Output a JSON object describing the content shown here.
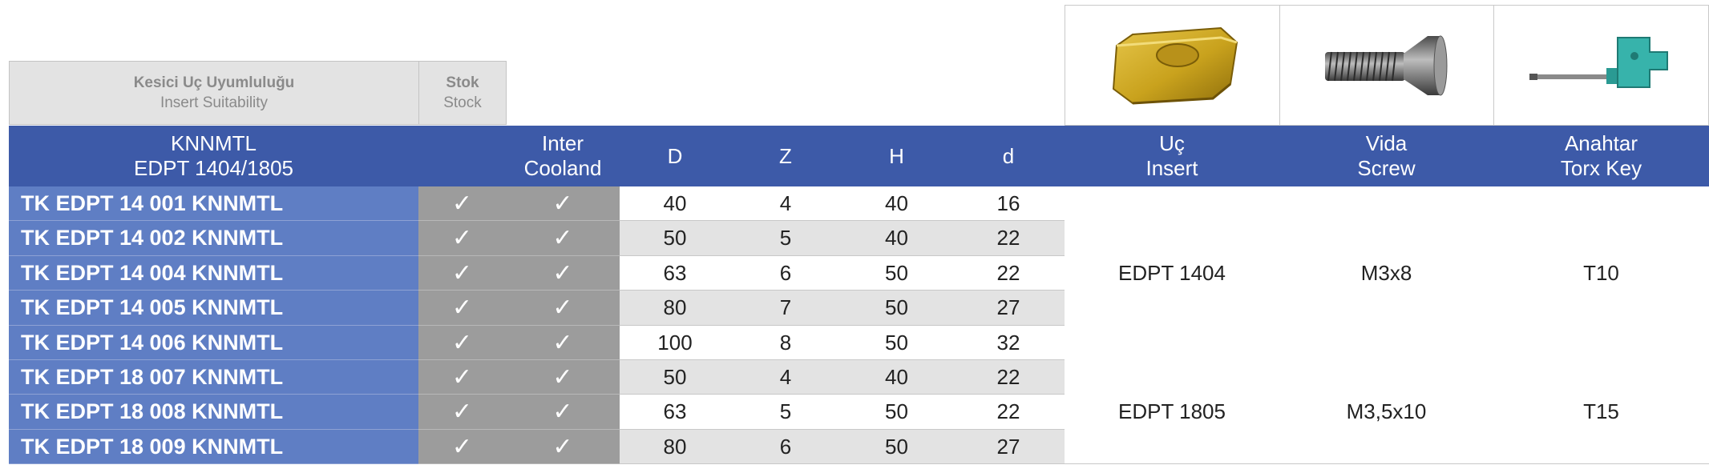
{
  "legend": {
    "suitability": {
      "tr": "Kesici Uç Uyumluluğu",
      "en": "Insert Suitability"
    },
    "stock": {
      "tr": "Stok",
      "en": "Stock"
    }
  },
  "images": [
    {
      "name": "insert-image",
      "icon": "insert-icon"
    },
    {
      "name": "screw-image",
      "icon": "screw-icon"
    },
    {
      "name": "torx-key-image",
      "icon": "torx-key-icon"
    }
  ],
  "colors": {
    "header_blue": "#3d5aa8",
    "name_blue": "#5f7ec4",
    "check_grey": "#9c9c9c",
    "row_alt": "#e3e3e3"
  },
  "header": {
    "series_line1": "KNNMTL",
    "series_line2": "EDPT 1404/1805",
    "stock_col": "",
    "coolant_line1": "Inter",
    "coolant_line2": "Cooland",
    "d_big": "D",
    "z": "Z",
    "h": "H",
    "d_small": "d",
    "insert_line1": "Uç",
    "insert_line2": "Insert",
    "screw_line1": "Vida",
    "screw_line2": "Screw",
    "key_line1": "Anahtar",
    "key_line2": "Torx Key"
  },
  "rows": [
    {
      "name": "TK EDPT 14 001 KNNMTL",
      "stock": "✓",
      "coolant": "✓",
      "D": "40",
      "Z": "4",
      "H": "40",
      "d": "16"
    },
    {
      "name": "TK EDPT 14 002 KNNMTL",
      "stock": "✓",
      "coolant": "✓",
      "D": "50",
      "Z": "5",
      "H": "40",
      "d": "22"
    },
    {
      "name": "TK EDPT 14 004 KNNMTL",
      "stock": "✓",
      "coolant": "✓",
      "D": "63",
      "Z": "6",
      "H": "50",
      "d": "22"
    },
    {
      "name": "TK EDPT 14 005 KNNMTL",
      "stock": "✓",
      "coolant": "✓",
      "D": "80",
      "Z": "7",
      "H": "50",
      "d": "27"
    },
    {
      "name": "TK EDPT 14 006 KNNMTL",
      "stock": "✓",
      "coolant": "✓",
      "D": "100",
      "Z": "8",
      "H": "50",
      "d": "32"
    },
    {
      "name": "TK EDPT 18 007 KNNMTL",
      "stock": "✓",
      "coolant": "✓",
      "D": "50",
      "Z": "4",
      "H": "40",
      "d": "22"
    },
    {
      "name": "TK EDPT 18 008 KNNMTL",
      "stock": "✓",
      "coolant": "✓",
      "D": "63",
      "Z": "5",
      "H": "50",
      "d": "22"
    },
    {
      "name": "TK EDPT 18 009 KNNMTL",
      "stock": "✓",
      "coolant": "✓",
      "D": "80",
      "Z": "6",
      "H": "50",
      "d": "27"
    }
  ],
  "groups": [
    {
      "insert": "EDPT 1404",
      "screw": "M3x8",
      "key": "T10"
    },
    {
      "insert": "EDPT 1805",
      "screw": "M3,5x10",
      "key": "T15"
    }
  ]
}
